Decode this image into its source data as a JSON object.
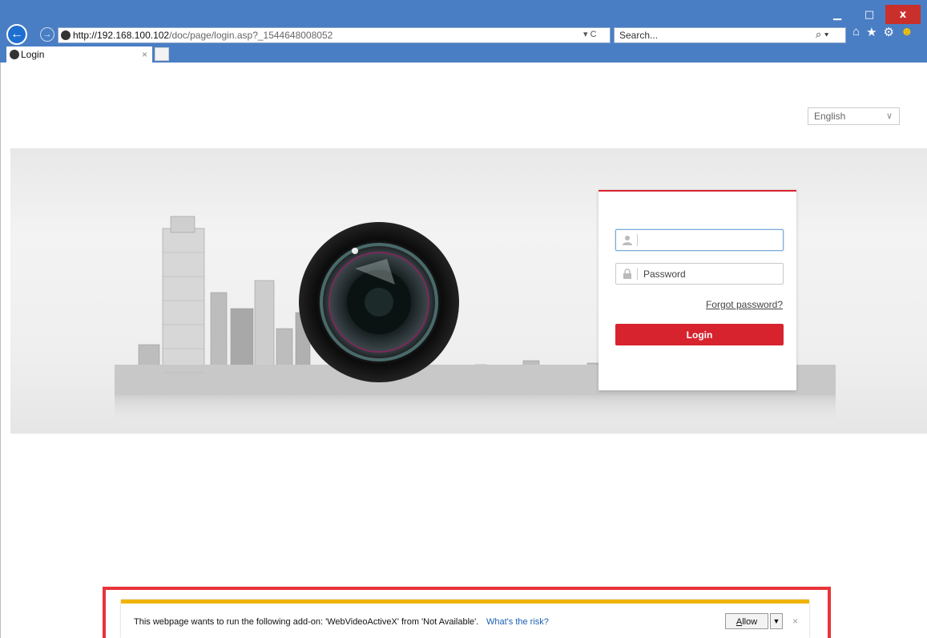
{
  "browser": {
    "window_controls": {
      "minimize": "▁",
      "maximize": "□",
      "close": "x"
    },
    "address": {
      "host": "http://192.168.100.102",
      "path": "/doc/page/login.asp?_1544648008052"
    },
    "address_tools": "▾ C",
    "search_placeholder": "Search...",
    "search_icon_glyph": "⌕ ▾",
    "toolbar_icons": [
      "home-icon",
      "favorites-star-icon",
      "settings-gear-icon",
      "feedback-smiley-icon"
    ],
    "tab": {
      "title": "Login",
      "close": "×"
    }
  },
  "page": {
    "language": {
      "selected": "English",
      "chevron": "∨"
    },
    "login": {
      "username_value": "",
      "password_placeholder": "Password",
      "forgot_label": "Forgot password?",
      "login_label": "Login"
    },
    "colors": {
      "accent": "#d7232e",
      "notif_border": "#e8343a",
      "notif_top": "#f0b400",
      "chrome": "#4a7ec4"
    }
  },
  "notification": {
    "message": "This webpage wants to run the following add-on: 'WebVideoActiveX' from 'Not Available'.",
    "link": "What's the risk?",
    "allow_first": "A",
    "allow_rest": "llow",
    "dropdown_glyph": "▼",
    "close": "×"
  }
}
